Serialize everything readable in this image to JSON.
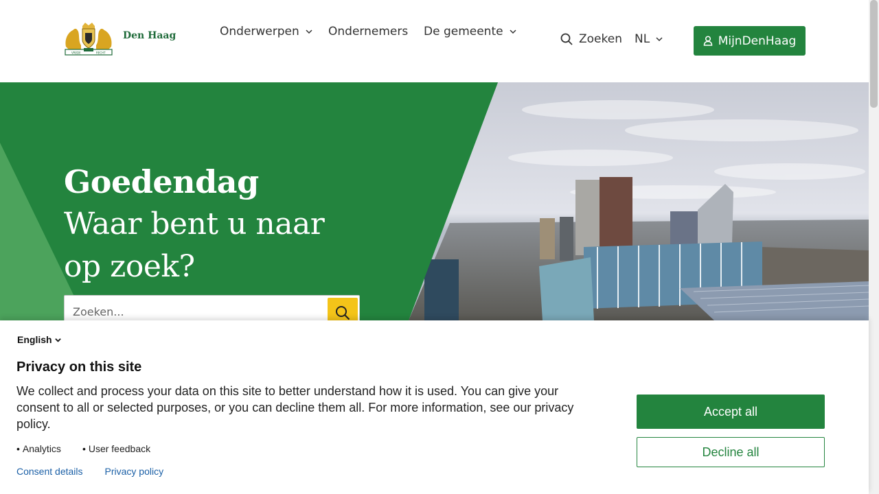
{
  "header": {
    "logo_text": "Den Haag",
    "nav": [
      {
        "label": "Onderwerpen",
        "has_dropdown": true
      },
      {
        "label": "Ondernemers",
        "has_dropdown": false
      },
      {
        "label": "De gemeente",
        "has_dropdown": true
      }
    ],
    "search_label": "Zoeken",
    "language": "NL",
    "account_button": "MijnDenHaag"
  },
  "hero": {
    "title": "Goedendag",
    "subtitle": "Waar bent u naar op zoek?",
    "search_placeholder": "Zoeken..."
  },
  "consent": {
    "language": "English",
    "title": "Privacy on this site",
    "text": "We collect and process your data on this site to better understand how it is used. You can give your consent to all or selected purposes, or you can decline them all. For more information, see our privacy policy.",
    "purposes": [
      "Analytics",
      "User feedback"
    ],
    "links": [
      "Consent details",
      "Privacy policy"
    ],
    "accept_label": "Accept all",
    "decline_label": "Decline all"
  },
  "colors": {
    "brand_green": "#23843e",
    "accent_yellow": "#f4c419",
    "link_blue": "#1a5fa6"
  },
  "icons": [
    "coat-of-arms-logo",
    "chevron-down-icon",
    "search-icon",
    "user-icon"
  ]
}
